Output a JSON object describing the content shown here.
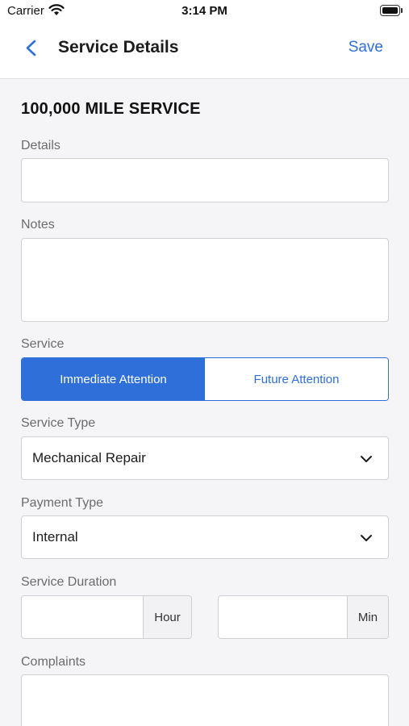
{
  "status_bar": {
    "carrier": "Carrier",
    "time": "3:14 PM"
  },
  "nav": {
    "title": "Service Details",
    "save_label": "Save",
    "back_icon": "chevron-left-icon"
  },
  "form": {
    "heading": "100,000 MILE SERVICE",
    "details": {
      "label": "Details",
      "value": ""
    },
    "notes": {
      "label": "Notes",
      "value": ""
    },
    "service": {
      "label": "Service",
      "options": [
        "Immediate Attention",
        "Future Attention"
      ],
      "selected": "Immediate Attention"
    },
    "service_type": {
      "label": "Service Type",
      "value": "Mechanical Repair"
    },
    "payment_type": {
      "label": "Payment Type",
      "value": "Internal"
    },
    "service_duration": {
      "label": "Service Duration",
      "hour_unit": "Hour",
      "min_unit": "Min",
      "hour_value": "",
      "min_value": ""
    },
    "complaints": {
      "label": "Complaints",
      "value": ""
    }
  },
  "colors": {
    "accent": "#2e6fd9",
    "background": "#f5f5f7",
    "field_border": "#cfcfd4",
    "label": "#6b6b70"
  }
}
